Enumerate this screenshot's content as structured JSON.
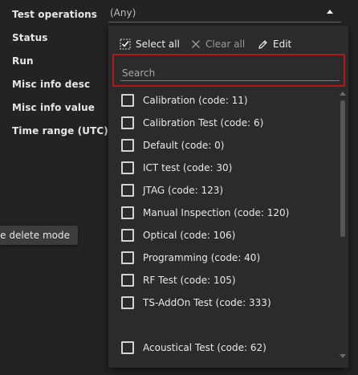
{
  "filters": {
    "labels": [
      "Test operations",
      "Status",
      "Run",
      "Misc info desc",
      "Misc info value",
      "Time range (UTC)"
    ],
    "test_operations_value": "(Any)"
  },
  "tooltip": {
    "text": "ble delete mode"
  },
  "dropdown": {
    "select_all": "Select all",
    "clear_all": "Clear all",
    "edit": "Edit",
    "search_placeholder": "Search",
    "options": [
      "Calibration (code: 11)",
      "Calibration Test (code: 6)",
      "Default (code: 0)",
      "ICT test (code: 30)",
      "JTAG (code: 123)",
      "Manual Inspection (code: 120)",
      "Optical (code: 106)",
      "Programming (code: 40)",
      "RF Test (code: 105)",
      "TS-AddOn Test (code: 333)",
      "Acoustical Test (code: 62)"
    ]
  },
  "colors": {
    "background": "#232323",
    "dropdown_bg": "#2b2b2b",
    "highlight_border": "#b01a1a"
  }
}
